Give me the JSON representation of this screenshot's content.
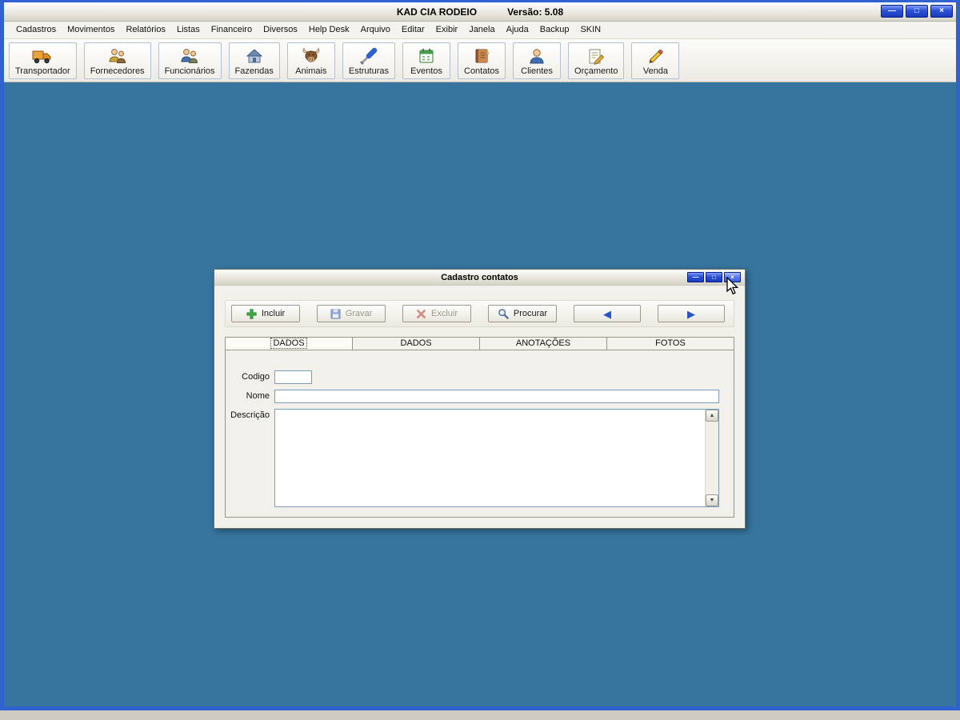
{
  "window": {
    "title": "KAD CIA RODEIO",
    "version": "Versão: 5.08"
  },
  "window_controls": {
    "minimize": "—",
    "maximize": "□",
    "close": "×"
  },
  "menu": {
    "items": [
      "Cadastros",
      "Movimentos",
      "Relatórios",
      "Listas",
      "Financeiro",
      "Diversos",
      "Help Desk",
      "Arquivo",
      "Editar",
      "Exibir",
      "Janela",
      "Ajuda",
      "Backup",
      "SKIN"
    ]
  },
  "toolbar": {
    "buttons": [
      {
        "label": "Transportador",
        "icon": "truck-icon"
      },
      {
        "label": "Fornecedores",
        "icon": "people-icon"
      },
      {
        "label": "Funcionários",
        "icon": "people-icon"
      },
      {
        "label": "Fazendas",
        "icon": "house-icon"
      },
      {
        "label": "Animais",
        "icon": "bull-icon"
      },
      {
        "label": "Estruturas",
        "icon": "screwdriver-icon"
      },
      {
        "label": "Eventos",
        "icon": "calendar-icon"
      },
      {
        "label": "Contatos",
        "icon": "address-book-icon"
      },
      {
        "label": "Clientes",
        "icon": "person-icon"
      },
      {
        "label": "Orçamento",
        "icon": "notepad-pencil-icon"
      },
      {
        "label": "Venda",
        "icon": "pencil-icon"
      }
    ]
  },
  "dialog": {
    "title": "Cadastro contatos",
    "toolbar": {
      "incluir_label": "Incluir",
      "gravar_label": "Gravar",
      "excluir_label": "Excluir",
      "procurar_label": "Procurar",
      "gravar_enabled": false,
      "excluir_enabled": false,
      "prev_glyph": "◀",
      "next_glyph": "▶"
    },
    "tabs": [
      {
        "label": "DADOS",
        "active": true
      },
      {
        "label": "DADOS",
        "active": false
      },
      {
        "label": "ANOTAÇÕES",
        "active": false
      },
      {
        "label": "FOTOS",
        "active": false
      }
    ],
    "form": {
      "codigo_label": "Codigo",
      "codigo_value": "",
      "nome_label": "Nome",
      "nome_value": "",
      "descricao_label": "Descrição",
      "descricao_value": ""
    },
    "scrollbar": {
      "up_glyph": "▲",
      "down_glyph": "▼"
    }
  }
}
